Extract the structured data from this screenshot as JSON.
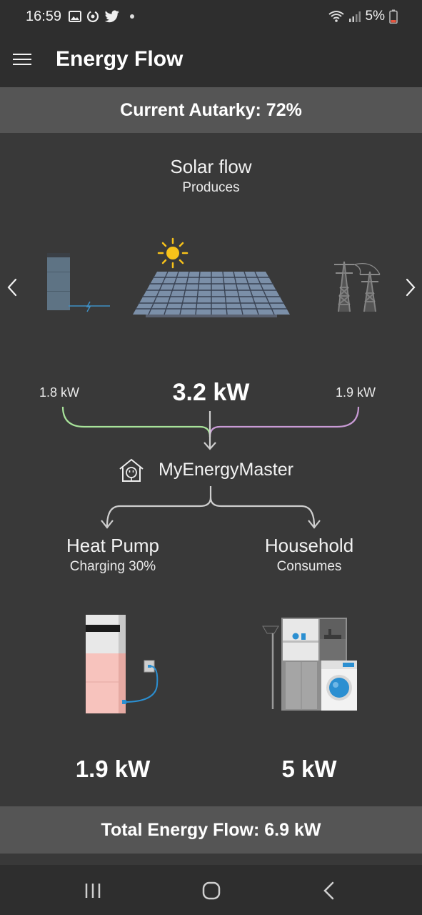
{
  "status": {
    "time": "16:59",
    "battery": "5%",
    "icons": [
      "image-icon",
      "sync-icon",
      "twitter-icon",
      "wifi-icon",
      "signal-icon",
      "battery-icon"
    ]
  },
  "app_bar": {
    "title": "Energy Flow",
    "menu_icon": "hamburger-menu-icon"
  },
  "autarky": {
    "text": "Current Autarky: 72%"
  },
  "solar": {
    "title": "Solar flow",
    "subtitle": "Produces",
    "total_kw": "3.2 kW",
    "left_kw": "1.8 kW",
    "right_kw": "1.9 kW",
    "left_flow_color": "#a8e39a",
    "right_flow_color": "#c99bd6"
  },
  "hub": {
    "label": "MyEnergyMaster",
    "icon": "house-plug-icon"
  },
  "heat_pump": {
    "title": "Heat Pump",
    "subtitle": "Charging 30%",
    "kw": "1.9 kW"
  },
  "household": {
    "title": "Household",
    "subtitle": "Consumes",
    "kw": "5 kW"
  },
  "total": {
    "text": "Total Energy Flow: 6.9 kW"
  },
  "colors": {
    "background": "#393939",
    "band": "#555555",
    "bars": "#2e2e2e",
    "battery_pink": "#f7c3bd",
    "accent_blue": "#2b8fd1",
    "sun_yellow": "#f7c21a"
  }
}
